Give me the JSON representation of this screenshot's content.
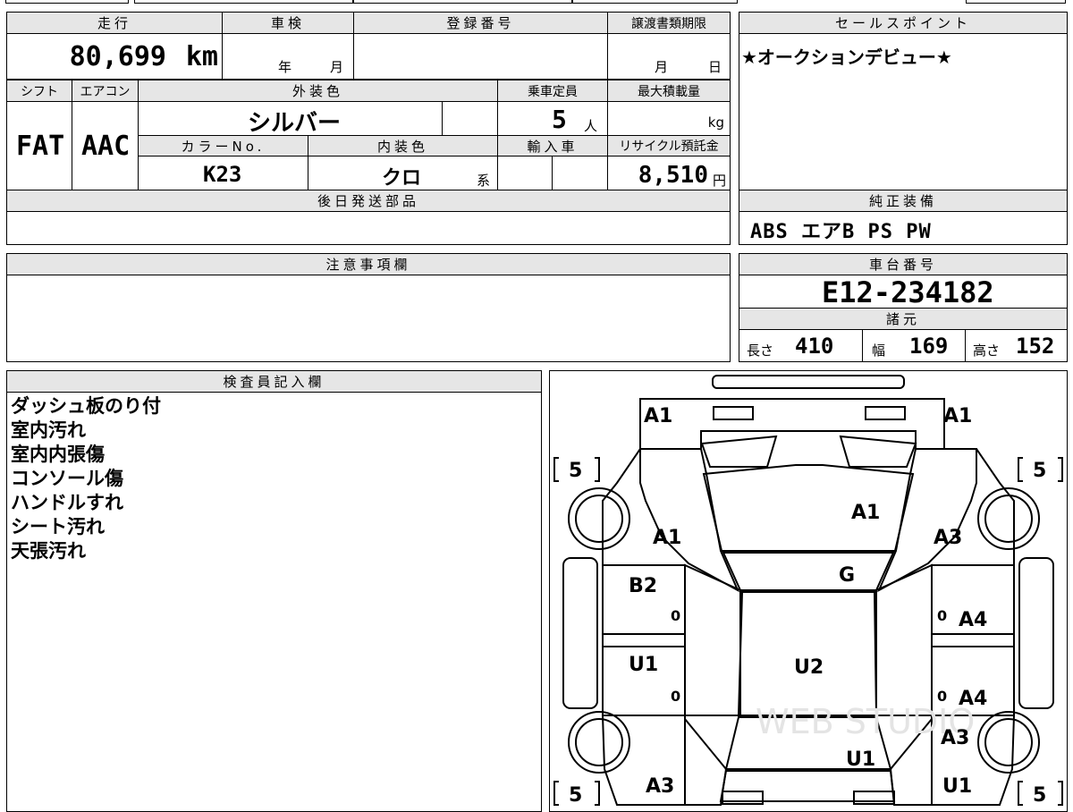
{
  "mileage": {
    "label": "走行",
    "value": "80,699",
    "unit": "km"
  },
  "shaken": {
    "label": "車検",
    "year": "年",
    "month": "月"
  },
  "registration": {
    "label": "登録番号"
  },
  "transfer": {
    "label": "譲渡書類期限",
    "month": "月",
    "day": "日"
  },
  "sales_point": {
    "label": "セールスポイント",
    "text": "★オークションデビュー★"
  },
  "shift": {
    "label": "シフト",
    "value": "FAT"
  },
  "aircon": {
    "label": "エアコン",
    "value": "AAC"
  },
  "exterior": {
    "label": "外装色",
    "value": "シルバー"
  },
  "capacity": {
    "label": "乗車定員",
    "value": "5",
    "unit": "人"
  },
  "max_load": {
    "label": "最大積載量",
    "unit": "kg"
  },
  "color_no": {
    "label": "カラーNo.",
    "value": "K23"
  },
  "interior": {
    "label": "内装色",
    "value": "クロ",
    "suffix": "系"
  },
  "import": {
    "label": "輸入車"
  },
  "recycle": {
    "label": "リサイクル預託金",
    "value": "8,510",
    "unit": "円"
  },
  "later_parts": {
    "label": "後日発送部品"
  },
  "genuine": {
    "label": "純正装備",
    "value": "ABS エアB PS PW"
  },
  "notes": {
    "label": "注意事項欄"
  },
  "chassis": {
    "label": "車台番号",
    "value": "E12-234182"
  },
  "specs": {
    "label": "諸元",
    "length_label": "長さ",
    "length": "410",
    "width_label": "幅",
    "width": "169",
    "height_label": "高さ",
    "height": "152"
  },
  "inspector": {
    "label": "検査員記入欄",
    "lines": [
      "ダッシュ板のり付",
      "室内汚れ",
      "室内内張傷",
      "コンソール傷",
      "ハンドルすれ",
      "シート汚れ",
      "天張汚れ"
    ]
  },
  "diagram": {
    "marks": {
      "front_left": "A1",
      "front_right": "A1",
      "tire_fl": "5",
      "tire_fr": "5",
      "tire_rl": "5",
      "tire_rr": "5",
      "hood": "A1",
      "fender_left": "A1",
      "fender_right": "A3",
      "windshield": "G",
      "front_door_left": "B2",
      "front_door_right": "A4",
      "rear_door_left": "U1",
      "rear_door_right": "A4",
      "roof": "U2",
      "rear_fender_right": "A3",
      "trunk": "U1",
      "rear_left": "A3",
      "rear_right": "U1",
      "handle_fl": "0",
      "handle_fr": "0",
      "handle_rl": "0",
      "handle_rr": "0"
    },
    "watermark": "WEB STUDIO"
  }
}
